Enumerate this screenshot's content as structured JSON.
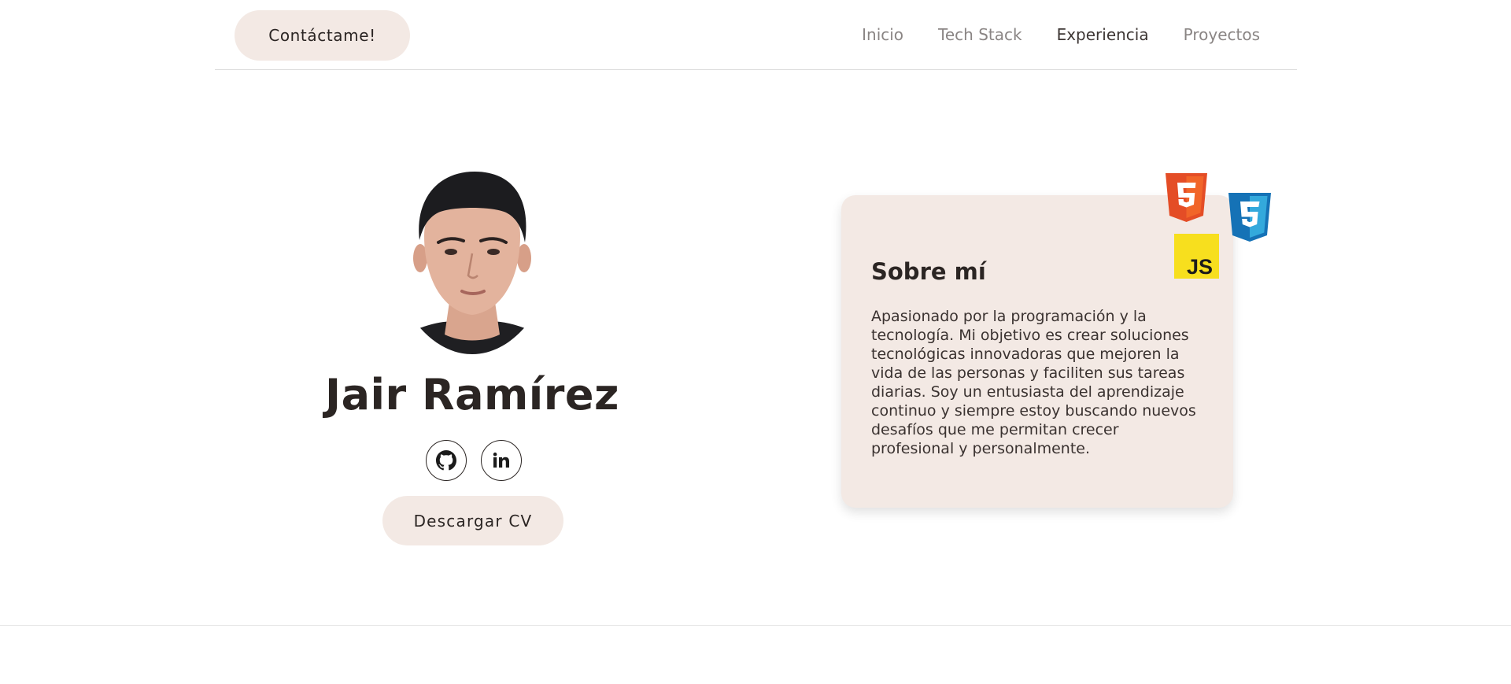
{
  "header": {
    "contact_label": "Contáctame!",
    "nav": [
      {
        "label": "Inicio",
        "active": false
      },
      {
        "label": "Tech Stack",
        "active": false
      },
      {
        "label": "Experiencia",
        "active": true
      },
      {
        "label": "Proyectos",
        "active": false
      }
    ]
  },
  "profile": {
    "name": "Jair Ramírez",
    "socials": [
      {
        "icon": "github-icon"
      },
      {
        "icon": "linkedin-icon"
      }
    ],
    "cv_label": "Descargar CV"
  },
  "about": {
    "title": "Sobre mí",
    "text": "Apasionado por la programación y la tecnología. Mi objetivo es crear soluciones tecnológicas innovadoras que mejoren la vida de las personas y faciliten sus tareas diarias. Soy un entusiasta del aprendizaje continuo y siempre estoy buscando nuevos desafíos que me permitan crecer profesional y personalmente.",
    "tech_icons": [
      "html5-icon",
      "css3-icon",
      "javascript-icon"
    ]
  },
  "colors": {
    "accent_bg": "#f3e9e4",
    "text_dark": "#2b2523",
    "nav_muted": "#8a8584",
    "html5": "#e44d26",
    "css3": "#1572b6",
    "js": "#f7df1e"
  }
}
